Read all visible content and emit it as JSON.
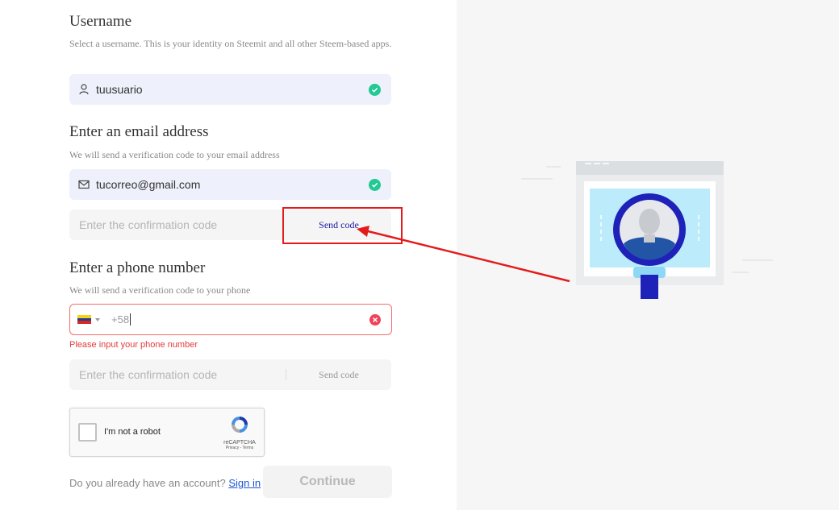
{
  "username": {
    "title": "Username",
    "description": "Select a username. This is your identity on Steemit and all other Steem-based apps.",
    "value": "tuusuario"
  },
  "email": {
    "title": "Enter an email address",
    "description": "We will send a verification code to your email address",
    "value": "tucorreo@gmail.com",
    "code_placeholder": "Enter the confirmation code",
    "send_code_label": "Send code"
  },
  "phone": {
    "title": "Enter a phone number",
    "description": "We will send a verification code to your phone",
    "prefix": "+58",
    "error": "Please input your phone number",
    "code_placeholder": "Enter the confirmation code",
    "send_code_label": "Send code"
  },
  "captcha": {
    "label": "I'm not a robot",
    "brand": "reCAPTCHA",
    "terms": "Privacy - Terms"
  },
  "footer": {
    "question": "Do you already have an account?",
    "sign_in": "Sign in",
    "continue": "Continue"
  },
  "colors": {
    "accent_link": "#1a1aa6",
    "success": "#22c993",
    "error": "#f0435a",
    "annotation": "#e31b1b"
  },
  "icons": {
    "username": "user-icon",
    "email": "mail-icon",
    "valid": "check-icon",
    "invalid": "close-icon"
  }
}
